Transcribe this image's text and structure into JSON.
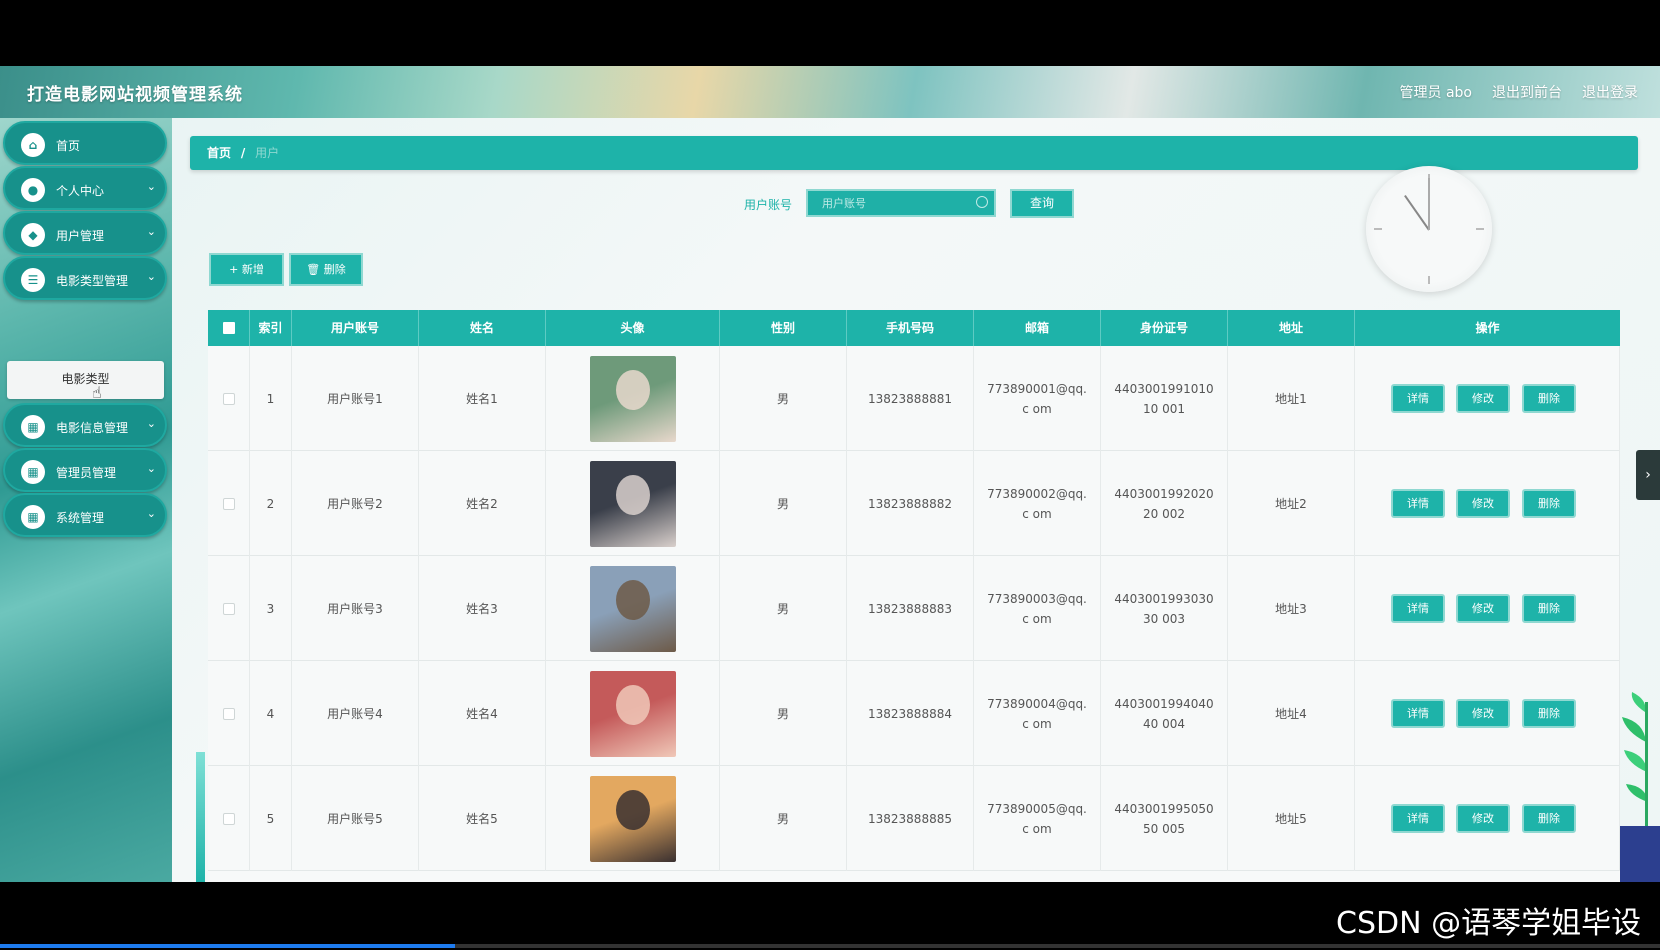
{
  "header": {
    "title": "打造电影网站视频管理系统",
    "admin": "管理员 abo",
    "front_link": "退出到前台",
    "logout_link": "退出登录"
  },
  "sidebar": {
    "items": [
      {
        "label": "首页",
        "icon": "home-icon"
      },
      {
        "label": "个人中心",
        "icon": "user-icon"
      },
      {
        "label": "用户管理",
        "icon": "users-icon"
      },
      {
        "label": "电影类型管理",
        "icon": "list-icon"
      },
      {
        "label": "电影信息管理",
        "icon": "grid-icon"
      },
      {
        "label": "管理员管理",
        "icon": "grid-icon"
      },
      {
        "label": "系统管理",
        "icon": "grid-icon"
      }
    ],
    "sub_item": "电影类型"
  },
  "breadcrumb": {
    "home": "首页",
    "separator": "/",
    "current": "用户"
  },
  "search": {
    "label": "用户账号",
    "placeholder": "用户账号",
    "button": "查询"
  },
  "toolbar": {
    "add": "+ 新增",
    "delete": "🗑 删除"
  },
  "table": {
    "headers": [
      "索引",
      "用户账号",
      "姓名",
      "头像",
      "性别",
      "手机号码",
      "邮箱",
      "身份证号",
      "地址",
      "操作"
    ],
    "rows": [
      {
        "index": "1",
        "account": "用户账号1",
        "name": "姓名1",
        "gender": "男",
        "phone": "13823888881",
        "email": "773890001@qq.c om",
        "id_card": "440300199101010 001",
        "address": "地址1"
      },
      {
        "index": "2",
        "account": "用户账号2",
        "name": "姓名2",
        "gender": "男",
        "phone": "13823888882",
        "email": "773890002@qq.c om",
        "id_card": "440300199202020 002",
        "address": "地址2"
      },
      {
        "index": "3",
        "account": "用户账号3",
        "name": "姓名3",
        "gender": "男",
        "phone": "13823888883",
        "email": "773890003@qq.c om",
        "id_card": "440300199303030 003",
        "address": "地址3"
      },
      {
        "index": "4",
        "account": "用户账号4",
        "name": "姓名4",
        "gender": "男",
        "phone": "13823888884",
        "email": "773890004@qq.c om",
        "id_card": "440300199404040 004",
        "address": "地址4"
      },
      {
        "index": "5",
        "account": "用户账号5",
        "name": "姓名5",
        "gender": "男",
        "phone": "13823888885",
        "email": "773890005@qq.c om",
        "id_card": "440300199505050 005",
        "address": "地址5"
      }
    ],
    "actions": {
      "detail": "详情",
      "edit": "修改",
      "delete": "删除"
    }
  },
  "watermark": "CSDN @语琴学姐毕设",
  "colors": {
    "accent": "#1eb3a9",
    "sidebar": "#17918b"
  }
}
